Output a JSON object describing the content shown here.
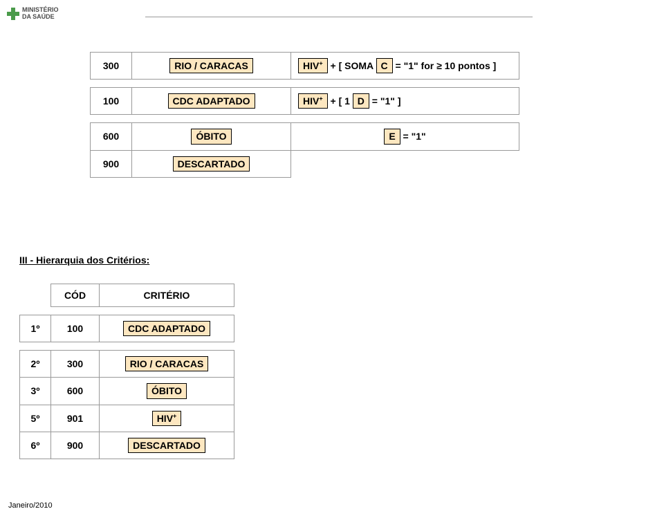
{
  "header": {
    "logo_line1": "MINISTÉRIO",
    "logo_line2": "DA SAÚDE"
  },
  "table1": {
    "rows": [
      {
        "num": "300",
        "label_chip": "RIO / CARACAS",
        "cond_prefix_chip": "HIV",
        "cond_prefix_sup": "+",
        "cond_mid": " + [ SOMA ",
        "cond_letter_chip": "C",
        "cond_after": " = \"1\" for ≥ 10 pontos ]"
      },
      {
        "num": "100",
        "label_chip": "CDC ADAPTADO",
        "cond_prefix_chip": "HIV",
        "cond_prefix_sup": "+",
        "cond_mid": " + [ 1 ",
        "cond_letter_chip": "D",
        "cond_after": " = \"1\" ]"
      },
      {
        "num": "600",
        "label_chip": "ÓBITO",
        "cond_letter_chip": "E",
        "cond_after": " = \"1\""
      },
      {
        "num": "900",
        "label_chip": "DESCARTADO"
      }
    ]
  },
  "section_title": "III - Hierarquia dos Critérios:",
  "table2": {
    "header": {
      "c2": "CÓD",
      "c3": "CRITÉRIO"
    },
    "rows": [
      {
        "c1": "1º",
        "c2": "100",
        "chip": "CDC ADAPTADO"
      },
      {
        "c1": "2º",
        "c2": "300",
        "chip": "RIO / CARACAS"
      },
      {
        "c1": "3º",
        "c2": "600",
        "chip": "ÓBITO"
      },
      {
        "c1": "5º",
        "c2": "901",
        "chip": "HIV",
        "sup": "+"
      },
      {
        "c1": "6º",
        "c2": "900",
        "chip": "DESCARTADO"
      }
    ]
  },
  "footer": "Janeiro/2010"
}
